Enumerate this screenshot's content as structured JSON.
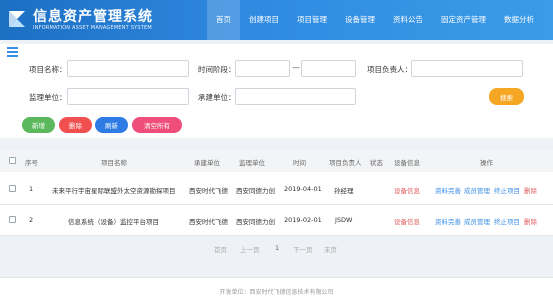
{
  "app": {
    "title": "信息资产管理系统",
    "subtitle": "INFORMATION ASSET MANAGEMENT SYSTEM"
  },
  "nav": [
    "首页",
    "创建项目",
    "项目管理",
    "设备管理",
    "资料公告",
    "固定资产管理",
    "数据分析"
  ],
  "colors": {
    "header": "#2f8ae0",
    "search": "#f5a623",
    "add": "#5cb85c",
    "delete": "#f05050",
    "refresh": "#2d7be5",
    "clear": "#f04e7a",
    "device_link": "#e05a5a",
    "link": "#3a8ee6",
    "delete_link": "#e05a5a"
  },
  "search": {
    "project_name_label": "项目名称：",
    "time_stage_label": "时间阶段：",
    "time_dash": "—",
    "project_owner_label": "项目负责人：",
    "supervisor_label": "监理单位：",
    "contractor_label": "承建单位：",
    "search_button": "搜索"
  },
  "actions": {
    "add": "新增",
    "delete": "删除",
    "refresh": "刷新",
    "clear": "清空所有"
  },
  "table": {
    "headers": [
      "序号",
      "项目名称",
      "承建单位",
      "监理单位",
      "时间",
      "项目负责人",
      "状态",
      "设备信息",
      "操作"
    ],
    "rows": [
      {
        "index": "1",
        "name": "未来平行宇宙星际联盟外太空资源勘探项目",
        "contractor": "西安时代飞德",
        "supervisor": "西安同德力创",
        "date": "2019-04-01",
        "owner": "孙经理",
        "status": "",
        "device": "设备信息",
        "ops": [
          "资料完善",
          "成员管理",
          "终止项目",
          "删除"
        ]
      },
      {
        "index": "2",
        "name": "信息系统（设备）监控平台项目",
        "contractor": "西安时代飞德",
        "supervisor": "西安同德力创",
        "date": "2019-02-01",
        "owner": "JSDW",
        "status": "",
        "device": "设备信息",
        "ops": [
          "资料完善",
          "成员管理",
          "终止项目",
          "删除"
        ]
      }
    ]
  },
  "pagination": {
    "first": "首页",
    "prev": "上一页",
    "current": "1",
    "next": "下一页",
    "last": "末页"
  },
  "footer": {
    "text": "开发单位：西安时代飞德信息技术有限公司"
  }
}
